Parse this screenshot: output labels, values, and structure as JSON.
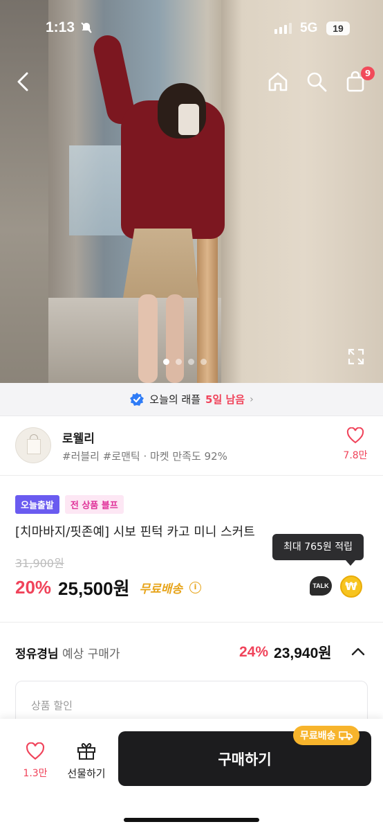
{
  "status_bar": {
    "time": "1:13",
    "network": "5G",
    "battery": "19"
  },
  "top_nav": {
    "cart_count": "9"
  },
  "hero": {
    "current_slide": 1,
    "total_slides": 4
  },
  "raffle": {
    "text": "오늘의 래플",
    "highlight": "5일 남음"
  },
  "shop": {
    "name": "로웰리",
    "tags": "#러블리 #로맨틱 · 마켓 만족도 92%",
    "likes": "7.8만"
  },
  "product": {
    "badge_today": "오늘출발",
    "badge_sale": "전 상품 블프",
    "title": "[치마바지/핏존예] 시보 핀턱 카고 미니 스커트",
    "original_price": "31,900원",
    "discount": "20%",
    "price": "25,500원",
    "shipping": "무료배송",
    "points_tooltip": "최대 765원 적립",
    "talk_label": "TALK",
    "coin_symbol": "₩"
  },
  "member_price": {
    "name": "정유경님",
    "label": "예상 구매가",
    "discount": "24%",
    "price": "23,940원"
  },
  "discount_box": {
    "label": "상품 할인"
  },
  "bottom_bar": {
    "likes": "1.3만",
    "gift_label": "선물하기",
    "buy_label": "구매하기",
    "free_ship_chip": "무료배송"
  },
  "colors": {
    "accent_red": "#f0435a",
    "shipping_yellow": "#e7a41a",
    "buy_button": "#1c1c1e"
  }
}
